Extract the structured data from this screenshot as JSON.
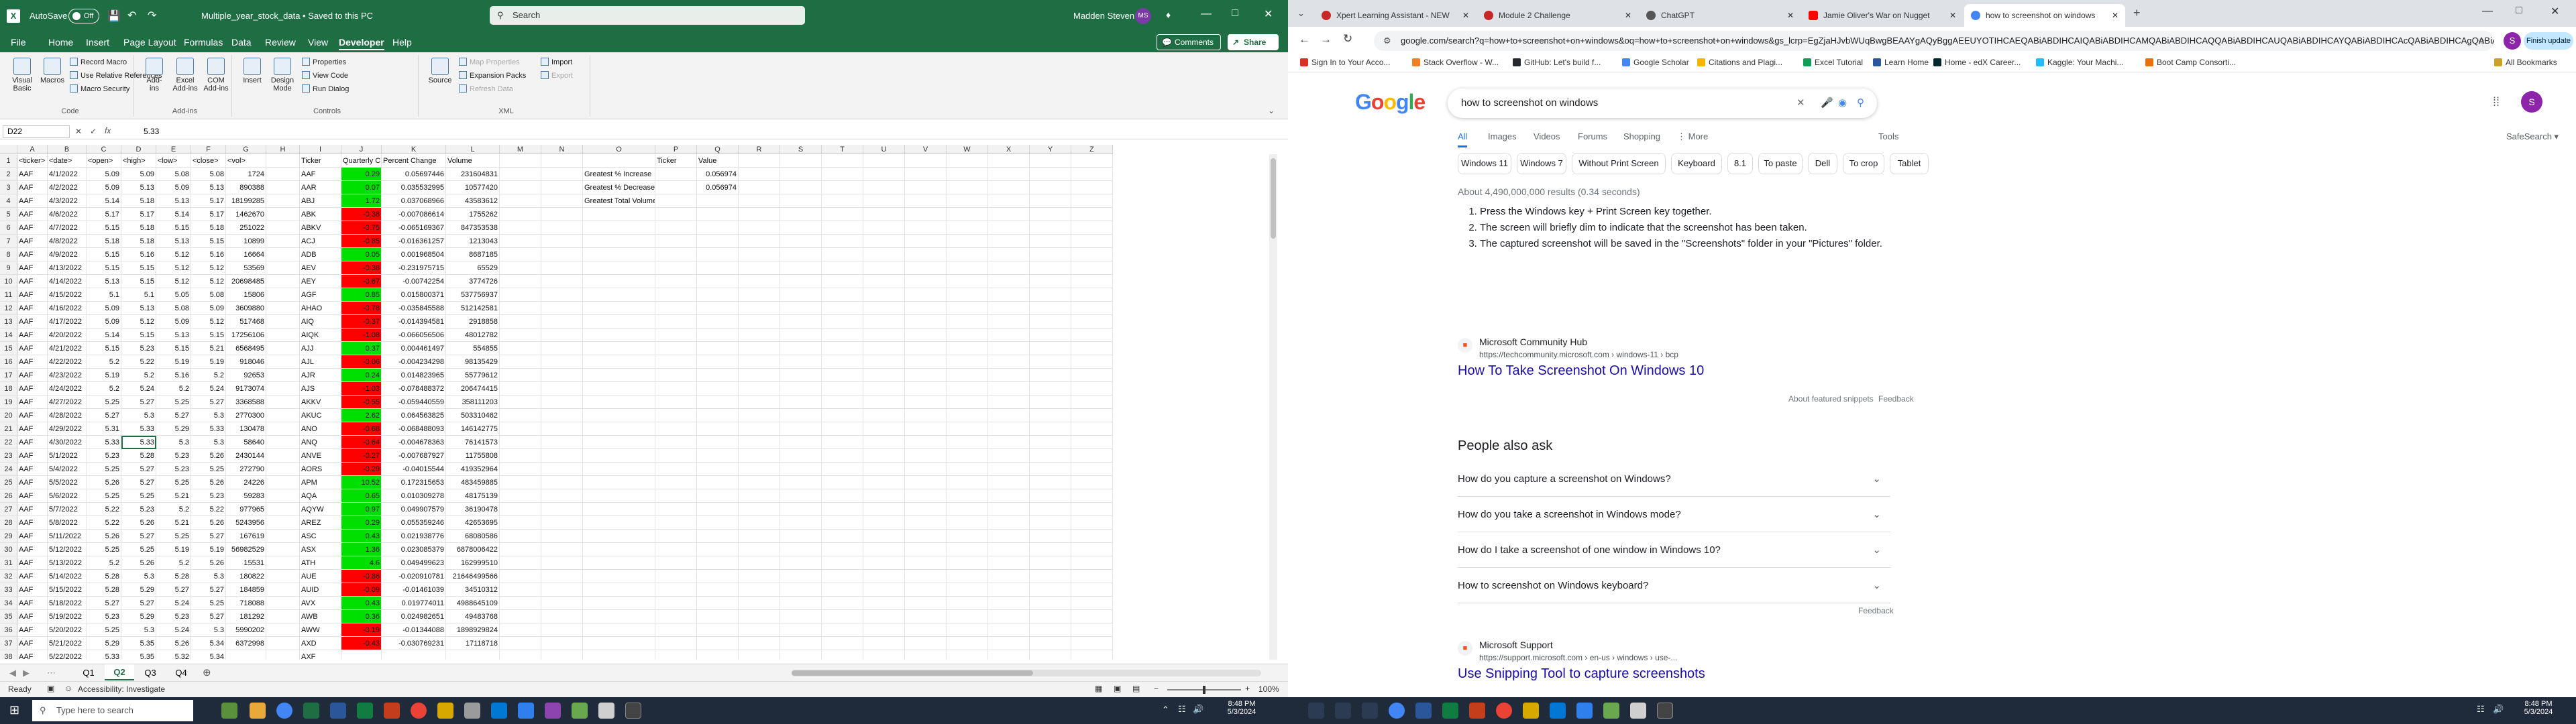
{
  "excel": {
    "autosave_label": "AutoSave",
    "autosave_state": "Off",
    "filename": "Multiple_year_stock_data • Saved to this PC",
    "search_placeholder": "Search",
    "user_name": "Madden Steven",
    "user_initials": "MS",
    "menu": [
      "File",
      "Home",
      "Insert",
      "Page Layout",
      "Formulas",
      "Data",
      "Review",
      "View",
      "Developer",
      "Help"
    ],
    "active_menu": "Developer",
    "comments_label": "Comments",
    "share_label": "Share",
    "ribbon": {
      "code": {
        "label": "Code",
        "visual_basic": "Visual Basic",
        "macros": "Macros",
        "record_macro": "Record Macro",
        "relative_refs": "Use Relative References",
        "macro_security": "Macro Security"
      },
      "addins": {
        "label": "Add-ins",
        "addins": "Add-ins",
        "excel_addins": "Excel Add-ins",
        "com_addins": "COM Add-ins"
      },
      "controls": {
        "label": "Controls",
        "insert": "Insert",
        "design_mode": "Design Mode",
        "properties": "Properties",
        "view_code": "View Code",
        "run_dialog": "Run Dialog"
      },
      "xml": {
        "label": "XML",
        "source": "Source",
        "map_properties": "Map Properties",
        "expansion_packs": "Expansion Packs",
        "refresh_data": "Refresh Data",
        "import": "Import",
        "export": "Export"
      }
    },
    "name_box": "D22",
    "formula_value": "5.33",
    "columns": [
      "A",
      "B",
      "C",
      "D",
      "E",
      "F",
      "G",
      "H",
      "I",
      "J",
      "K",
      "L",
      "M",
      "N",
      "O",
      "P",
      "Q",
      "R",
      "S",
      "T",
      "U",
      "V",
      "W",
      "X",
      "Y",
      "Z"
    ],
    "headers": [
      "<ticker>",
      "<date>",
      "<open>",
      "<high>",
      "<low>",
      "<close>",
      "<vol>",
      "",
      "Ticker",
      "Quarterly Change",
      "Percent Change",
      "Volume"
    ],
    "rows": [
      [
        "AAF",
        "4/1/2022",
        "5.09",
        "5.09",
        "5.08",
        "5.08",
        "1724",
        "",
        "AAF",
        "0.29",
        "0.05697446",
        "231604831"
      ],
      [
        "AAF",
        "4/2/2022",
        "5.09",
        "5.13",
        "5.09",
        "5.13",
        "890388",
        "",
        "AAR",
        "0.07",
        "0.035532995",
        "10577420"
      ],
      [
        "AAF",
        "4/3/2022",
        "5.14",
        "5.18",
        "5.13",
        "5.17",
        "18199285",
        "",
        "ABJ",
        "1.72",
        "0.037068966",
        "43583612"
      ],
      [
        "AAF",
        "4/6/2022",
        "5.17",
        "5.17",
        "5.14",
        "5.17",
        "1462670",
        "",
        "ABK",
        "-0.38",
        "-0.007086614",
        "1755262"
      ],
      [
        "AAF",
        "4/7/2022",
        "5.15",
        "5.18",
        "5.15",
        "5.18",
        "251022",
        "",
        "ABKV",
        "-0.75",
        "-0.065169367",
        "847353538"
      ],
      [
        "AAF",
        "4/8/2022",
        "5.18",
        "5.18",
        "5.13",
        "5.15",
        "10899",
        "",
        "ACJ",
        "-0.85",
        "-0.016361257",
        "1213043"
      ],
      [
        "AAF",
        "4/9/2022",
        "5.15",
        "5.16",
        "5.12",
        "5.16",
        "16664",
        "",
        "ADB",
        "0.05",
        "0.001968504",
        "8687185"
      ],
      [
        "AAF",
        "4/13/2022",
        "5.15",
        "5.15",
        "5.12",
        "5.12",
        "53569",
        "",
        "AEV",
        "-0.38",
        "-0.231975715",
        "65529"
      ],
      [
        "AAF",
        "4/14/2022",
        "5.13",
        "5.15",
        "5.12",
        "5.12",
        "20698485",
        "",
        "AEY",
        "-0.67",
        "-0.00742254",
        "3774726"
      ],
      [
        "AAF",
        "4/15/2022",
        "5.1",
        "5.1",
        "5.05",
        "5.08",
        "15806",
        "",
        "AGF",
        "0.85",
        "0.015800371",
        "537756937"
      ],
      [
        "AAF",
        "4/16/2022",
        "5.09",
        "5.13",
        "5.08",
        "5.09",
        "3609880",
        "",
        "AHAO",
        "-0.78",
        "-0.035845588",
        "512142581"
      ],
      [
        "AAF",
        "4/17/2022",
        "5.09",
        "5.12",
        "5.09",
        "5.12",
        "517468",
        "",
        "AIQ",
        "-0.37",
        "-0.014394581",
        "2918858"
      ],
      [
        "AAF",
        "4/20/2022",
        "5.14",
        "5.15",
        "5.13",
        "5.15",
        "17256106",
        "",
        "AIQK",
        "-1.08",
        "-0.066056506",
        "48012782"
      ],
      [
        "AAF",
        "4/21/2022",
        "5.15",
        "5.23",
        "5.15",
        "5.21",
        "6568495",
        "",
        "AJJ",
        "0.37",
        "0.004461497",
        "554855"
      ],
      [
        "AAF",
        "4/22/2022",
        "5.2",
        "5.22",
        "5.19",
        "5.19",
        "918046",
        "",
        "AJL",
        "-0.06",
        "-0.004234298",
        "98135429"
      ],
      [
        "AAF",
        "4/23/2022",
        "5.19",
        "5.2",
        "5.16",
        "5.2",
        "92653",
        "",
        "AJR",
        "0.24",
        "0.014823965",
        "55779612"
      ],
      [
        "AAF",
        "4/24/2022",
        "5.2",
        "5.24",
        "5.2",
        "5.24",
        "9173074",
        "",
        "AJS",
        "-1.03",
        "-0.078488372",
        "206474415"
      ],
      [
        "AAF",
        "4/27/2022",
        "5.25",
        "5.27",
        "5.25",
        "5.27",
        "3368588",
        "",
        "AKKV",
        "-0.55",
        "-0.059440559",
        "358111203"
      ],
      [
        "AAF",
        "4/28/2022",
        "5.27",
        "5.3",
        "5.27",
        "5.3",
        "2770300",
        "",
        "AKUC",
        "2.62",
        "0.064563825",
        "503310462"
      ],
      [
        "AAF",
        "4/29/2022",
        "5.31",
        "5.33",
        "5.29",
        "5.33",
        "130478",
        "",
        "ANO",
        "-0.68",
        "-0.068488093",
        "146142775"
      ],
      [
        "AAF",
        "4/30/2022",
        "5.33",
        "5.33",
        "5.3",
        "5.3",
        "58640",
        "",
        "ANQ",
        "-0.64",
        "-0.004678363",
        "76141573"
      ],
      [
        "AAF",
        "5/1/2022",
        "5.23",
        "5.28",
        "5.23",
        "5.26",
        "2430144",
        "",
        "ANVE",
        "-0.27",
        "-0.007687927",
        "11755808"
      ],
      [
        "AAF",
        "5/4/2022",
        "5.25",
        "5.27",
        "5.23",
        "5.25",
        "272790",
        "",
        "AORS",
        "-0.29",
        "-0.04015544",
        "419352964"
      ],
      [
        "AAF",
        "5/5/2022",
        "5.26",
        "5.27",
        "5.25",
        "5.26",
        "24226",
        "",
        "APM",
        "10.52",
        "0.172315653",
        "483459885"
      ],
      [
        "AAF",
        "5/6/2022",
        "5.25",
        "5.25",
        "5.21",
        "5.23",
        "59283",
        "",
        "AQA",
        "0.65",
        "0.010309278",
        "48175139"
      ],
      [
        "AAF",
        "5/7/2022",
        "5.22",
        "5.23",
        "5.2",
        "5.22",
        "977965",
        "",
        "AQYW",
        "0.97",
        "0.049907579",
        "36190478"
      ],
      [
        "AAF",
        "5/8/2022",
        "5.22",
        "5.26",
        "5.21",
        "5.26",
        "5243956",
        "",
        "AREZ",
        "0.29",
        "0.055359246",
        "42653695"
      ],
      [
        "AAF",
        "5/11/2022",
        "5.26",
        "5.27",
        "5.25",
        "5.27",
        "167619",
        "",
        "ASC",
        "0.43",
        "0.021938776",
        "68080586"
      ],
      [
        "AAF",
        "5/12/2022",
        "5.25",
        "5.25",
        "5.19",
        "5.19",
        "56982529",
        "",
        "ASX",
        "1.36",
        "0.023085379",
        "6878006422"
      ],
      [
        "AAF",
        "5/13/2022",
        "5.2",
        "5.26",
        "5.2",
        "5.26",
        "15531",
        "",
        "ATH",
        "4.6",
        "0.049499623",
        "162999510"
      ],
      [
        "AAF",
        "5/14/2022",
        "5.28",
        "5.3",
        "5.28",
        "5.3",
        "180822",
        "",
        "AUE",
        "-0.86",
        "-0.020910781",
        "21646499566"
      ],
      [
        "AAF",
        "5/15/2022",
        "5.28",
        "5.29",
        "5.27",
        "5.27",
        "184859",
        "",
        "AUID",
        "-0.09",
        "-0.01461039",
        "34510312"
      ],
      [
        "AAF",
        "5/18/2022",
        "5.27",
        "5.27",
        "5.24",
        "5.25",
        "718088",
        "",
        "AVX",
        "0.43",
        "0.019774011",
        "4988645109"
      ],
      [
        "AAF",
        "5/19/2022",
        "5.23",
        "5.29",
        "5.23",
        "5.27",
        "181292",
        "",
        "AWB",
        "0.36",
        "0.024982651",
        "49483768"
      ],
      [
        "AAF",
        "5/20/2022",
        "5.25",
        "5.3",
        "5.24",
        "5.3",
        "5990202",
        "",
        "AWW",
        "-0.19",
        "-0.01344088",
        "1898929824"
      ],
      [
        "AAF",
        "5/21/2022",
        "5.29",
        "5.35",
        "5.26",
        "5.34",
        "6372998",
        "",
        "AXD",
        "-0.43",
        "-0.030769231",
        "17118718"
      ],
      [
        "AAF",
        "5/22/2022",
        "5.33",
        "5.35",
        "5.32",
        "5.34",
        "",
        "",
        "AXF",
        "",
        "",
        ""
      ]
    ],
    "summary": {
      "col_labels": [
        "Ticker",
        "Value"
      ],
      "labels": [
        "Greatest % Increase",
        "Greatest % Decrease",
        "Greatest Total Volume"
      ],
      "values": [
        "0.056974",
        "0.056974",
        ""
      ]
    },
    "sheets": [
      "Q1",
      "Q2",
      "Q3",
      "Q4"
    ],
    "active_sheet": "Q2",
    "status": {
      "ready": "Ready",
      "accessibility": "Accessibility: Investigate",
      "zoom": "100%"
    }
  },
  "chrome": {
    "tabs": [
      {
        "title": "Xpert Learning Assistant - NEW",
        "color": "#c62828"
      },
      {
        "title": "Module 2 Challenge",
        "color": "#c62828"
      },
      {
        "title": "ChatGPT",
        "color": "#c62828"
      },
      {
        "title": "Jamie Oliver's War on Nugget",
        "color": "#ff0000"
      },
      {
        "title": "how to screenshot on windows",
        "color": "#4285f4"
      }
    ],
    "active_tab": 4,
    "url": "google.com/search?q=how+to+screenshot+on+windows&oq=how+to+screenshot+on+windows&gs_lcrp=EgZjaHJvbWUqBwgBEAAYgAQyBggAEEUYOTIHCAEQABiABDIHCAIQABiABDIHCAMQABiABDIHCAQQABiABDIHCAUQABiABDIHCAYQABiABDIHCAcQABiABDIHCAgQABiABDIHCAkQABiABNIBCDQ0Mjdq",
    "finish_update": "Finish update",
    "profile_initial": "S",
    "bookmarks": [
      "Sign In to Your Acco...",
      "Stack Overflow - W...",
      "GitHub: Let's build f...",
      "Google Scholar",
      "Citations and Plagi...",
      "Excel Tutorial",
      "Learn Home",
      "Home - edX Career...",
      "Kaggle: Your Machi...",
      "Boot Camp Consorti..."
    ],
    "all_bookmarks": "All Bookmarks",
    "google": {
      "logo": [
        "G",
        "o",
        "o",
        "g",
        "l",
        "e"
      ],
      "query": "how to screenshot on windows",
      "tabs": [
        "All",
        "Images",
        "Videos",
        "Forums",
        "Shopping",
        "More"
      ],
      "tools": "Tools",
      "safesearch": "SafeSearch",
      "chips": [
        "Windows 11",
        "Windows 7",
        "Without Print Screen",
        "Keyboard",
        "8.1",
        "To paste",
        "Dell",
        "To crop",
        "Tablet"
      ],
      "result_stats": "About 4,490,000,000 results (0.34 seconds)",
      "steps": [
        "Press the Windows key + Print Screen key together.",
        "The screen will briefly dim to indicate that the screenshot has been taken.",
        "The captured screenshot will be saved in the \"Screenshots\" folder in your \"Pictures\" folder."
      ],
      "result1": {
        "site": "Microsoft Community Hub",
        "url": "https://techcommunity.microsoft.com › windows-11 › bcp",
        "title": "How To Take Screenshot On Windows 10"
      },
      "about_snippets": "About featured snippets",
      "feedback": "Feedback",
      "paa_title": "People also ask",
      "paa": [
        "How do you capture a screenshot on Windows?",
        "How do you take a screenshot in Windows mode?",
        "How do I take a screenshot of one window in Windows 10?",
        "How to screenshot on Windows keyboard?"
      ],
      "result2": {
        "site": "Microsoft Support",
        "url": "https://support.microsoft.com › en-us › windows › use-...",
        "title": "Use Snipping Tool to capture screenshots"
      }
    }
  },
  "taskbar": {
    "search_placeholder": "Type here to search",
    "time_left": "8:48 PM",
    "date_left": "5/3/2024",
    "time_right": "8:48 PM",
    "date_right": "5/3/2024"
  },
  "colors": {
    "excel_green": "#1f6e43",
    "pos": "#00e000",
    "neg": "#ff0000",
    "google_blue": "#1a0dab"
  }
}
